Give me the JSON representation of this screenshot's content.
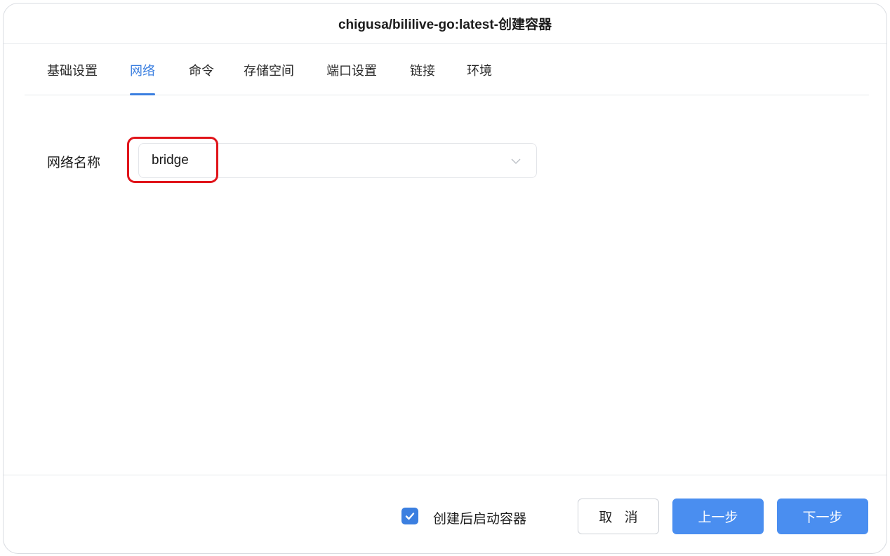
{
  "dialog": {
    "title": "chigusa/bililive-go:latest-创建容器"
  },
  "tabs": [
    {
      "label": "基础设置",
      "active": false
    },
    {
      "label": "网络",
      "active": true
    },
    {
      "label": "命令",
      "active": false
    },
    {
      "label": "存储空间",
      "active": false
    },
    {
      "label": "端口设置",
      "active": false
    },
    {
      "label": "链接",
      "active": false
    },
    {
      "label": "环境",
      "active": false
    }
  ],
  "network": {
    "field_label": "网络名称",
    "selected_value": "bridge",
    "dropdown_icon": "chevron-down-icon"
  },
  "footer": {
    "start_after_create_checked": true,
    "start_after_create_label": "创建后启动容器",
    "cancel_label": "取 消",
    "prev_label": "上一步",
    "next_label": "下一步"
  },
  "colors": {
    "accent": "#3b7fe0",
    "primary_button": "#4a8ef0",
    "highlight_border": "#e0141a"
  }
}
